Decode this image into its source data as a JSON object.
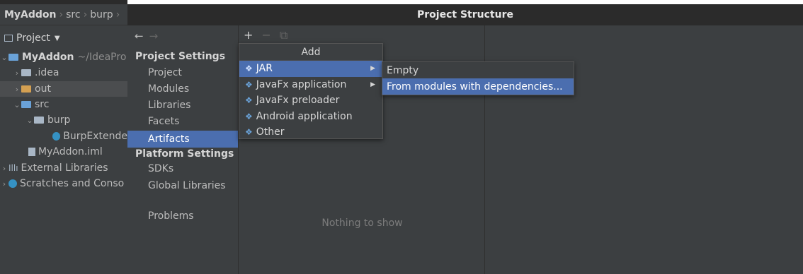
{
  "ide": {
    "breadcrumb": [
      "MyAddon",
      "src",
      "burp"
    ],
    "project_label": "Project",
    "tree": [
      {
        "label": "MyAddon",
        "suffix": "~/IdeaPro",
        "depth": 0,
        "arrow": "expanded",
        "bold": true
      },
      {
        "label": ".idea",
        "depth": 1,
        "arrow": "collapsed"
      },
      {
        "label": "out",
        "depth": 1,
        "arrow": "collapsed"
      },
      {
        "label": "src",
        "depth": 1,
        "arrow": "expanded"
      },
      {
        "label": "burp",
        "depth": 2,
        "arrow": "expanded"
      },
      {
        "label": "BurpExtende",
        "depth": 3,
        "arrow": "none"
      },
      {
        "label": "MyAddon.iml",
        "depth": 2,
        "arrow": "none"
      },
      {
        "label": "External Libraries",
        "depth": 0,
        "arrow": "collapsed"
      },
      {
        "label": "Scratches and Conso",
        "depth": 0,
        "arrow": "collapsed"
      }
    ]
  },
  "dialog": {
    "title": "Project Structure",
    "project_settings_header": "Project Settings",
    "project_settings_items": [
      "Project",
      "Modules",
      "Libraries",
      "Facets",
      "Artifacts"
    ],
    "platform_settings_header": "Platform Settings",
    "platform_settings_items": [
      "SDKs",
      "Global Libraries"
    ],
    "problems_label": "Problems",
    "empty_text": "Nothing to show"
  },
  "add_menu": {
    "title": "Add",
    "items": [
      "JAR",
      "JavaFx application",
      "JavaFx preloader",
      "Android application",
      "Other"
    ]
  },
  "jar_submenu": {
    "items": [
      "Empty",
      "From modules with dependencies..."
    ]
  },
  "colors": {
    "selection": "#4b6eaf",
    "panel_bg": "#3c3f41",
    "title_bg": "#2b2b2b"
  }
}
